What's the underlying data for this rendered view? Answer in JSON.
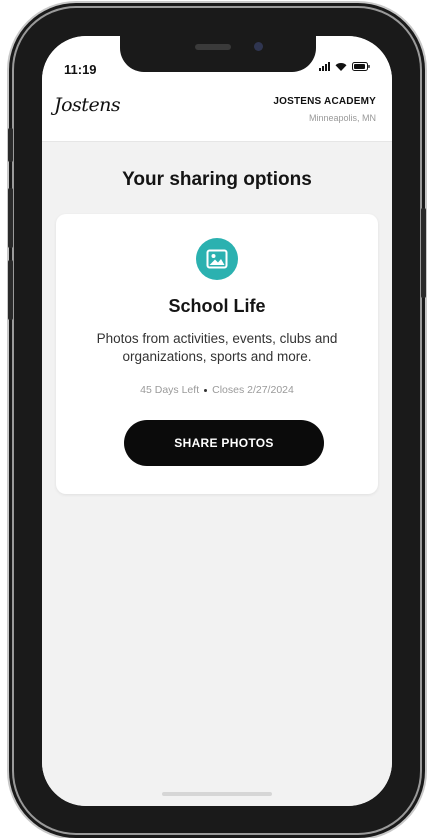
{
  "status_bar": {
    "time": "11:19",
    "icons": [
      "signal-icon",
      "wifi-icon",
      "battery-icon"
    ]
  },
  "header": {
    "logo_text": "Jostens",
    "school_name": "JOSTENS ACADEMY",
    "school_location": "Minneapolis, MN"
  },
  "main": {
    "title": "Your sharing options",
    "card": {
      "icon": "image-icon",
      "title": "School Life",
      "description": "Photos from activities, events, clubs and organizations, sports and more.",
      "days_left": "45 Days Left",
      "closes": "Closes 2/27/2024",
      "button_label": "SHARE PHOTOS"
    }
  },
  "colors": {
    "accent_teal": "#2bb1b0",
    "button_black": "#0b0b0b",
    "background": "#f2f2f2"
  }
}
